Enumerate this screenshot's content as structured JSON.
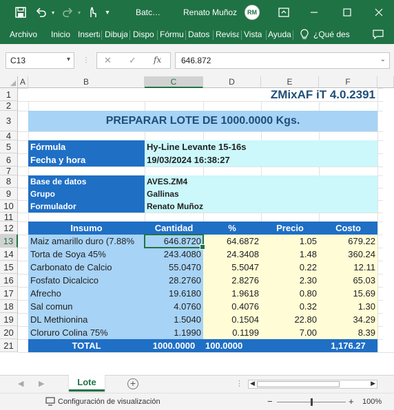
{
  "titlebar": {
    "filename": "Batc…",
    "user": "Renato Muñoz",
    "avatar_initials": "RM",
    "icons": [
      "save-icon",
      "undo-icon",
      "redo-icon",
      "touch-mode-icon",
      "customize-icon",
      "ribbon-display-icon",
      "minimize-icon",
      "maximize-icon",
      "close-icon"
    ]
  },
  "ribbon": {
    "tabs": [
      "Archivo",
      "Inicio",
      "Inserta",
      "Dibuja",
      "Dispo",
      "Fórmu",
      "Datos",
      "Revisa",
      "Vista",
      "Ayuda"
    ],
    "tell_me": "¿Qué des"
  },
  "formula_bar": {
    "name_box": "C13",
    "cancel": "✕",
    "enter": "✓",
    "fx": "fx",
    "content": "646.872"
  },
  "grid": {
    "columns": [
      "A",
      "B",
      "C",
      "D",
      "E",
      "F"
    ],
    "rows": [
      "1",
      "2",
      "3",
      "4",
      "5",
      "6",
      "7",
      "8",
      "9",
      "10",
      "11",
      "12",
      "13",
      "14",
      "15",
      "16",
      "17",
      "18",
      "19",
      "20",
      "21"
    ],
    "selected_cell": "C13",
    "accent": "#1f6fc5"
  },
  "sheet": {
    "app_version": "ZMixAF iT 4.0.2391",
    "header": "PREPARAR LOTE DE  1000.0000 Kgs.",
    "info": [
      {
        "label": "Fórmula",
        "value": "Hy-Line Levante 15-16s"
      },
      {
        "label": "Fecha y hora",
        "value": "19/03/2024 16:38:27"
      }
    ],
    "meta": [
      {
        "label": "Base de datos",
        "value": "AVES.ZM4"
      },
      {
        "label": "Grupo",
        "value": "Gallinas"
      },
      {
        "label": "Formulador",
        "value": "Renato Muñoz"
      }
    ],
    "table_headers": [
      "Insumo",
      "Cantidad",
      "%",
      "Precio",
      "Costo"
    ],
    "rows": [
      {
        "insumo": "Maiz amarillo duro (7.88%",
        "cantidad": "646.8720",
        "pct": "64.6872",
        "precio": "1.05",
        "costo": "679.22"
      },
      {
        "insumo": "Torta de Soya 45%",
        "cantidad": "243.4080",
        "pct": "24.3408",
        "precio": "1.48",
        "costo": "360.24"
      },
      {
        "insumo": "Carbonato de Calcio",
        "cantidad": "55.0470",
        "pct": "5.5047",
        "precio": "0.22",
        "costo": "12.11"
      },
      {
        "insumo": "Fosfato Dicalcico",
        "cantidad": "28.2760",
        "pct": "2.8276",
        "precio": "2.30",
        "costo": "65.03"
      },
      {
        "insumo": "Afrecho",
        "cantidad": "19.6180",
        "pct": "1.9618",
        "precio": "0.80",
        "costo": "15.69"
      },
      {
        "insumo": "Sal comun",
        "cantidad": "4.0760",
        "pct": "0.4076",
        "precio": "0.32",
        "costo": "1.30"
      },
      {
        "insumo": "DL Methionina",
        "cantidad": "1.5040",
        "pct": "0.1504",
        "precio": "22.80",
        "costo": "34.29"
      },
      {
        "insumo": "Cloruro Colina 75%",
        "cantidad": "1.1990",
        "pct": "0.1199",
        "precio": "7.00",
        "costo": "8.39"
      }
    ],
    "total": {
      "label": "TOTAL",
      "cantidad": "1000.0000",
      "pct": "100.0000",
      "costo": "1,176.27"
    }
  },
  "sheet_tabs": {
    "active": "Lote",
    "add_label": "+"
  },
  "status": {
    "display_settings": "Configuración de visualización",
    "zoom_minus": "−",
    "zoom_plus": "+",
    "zoom": "100%"
  }
}
